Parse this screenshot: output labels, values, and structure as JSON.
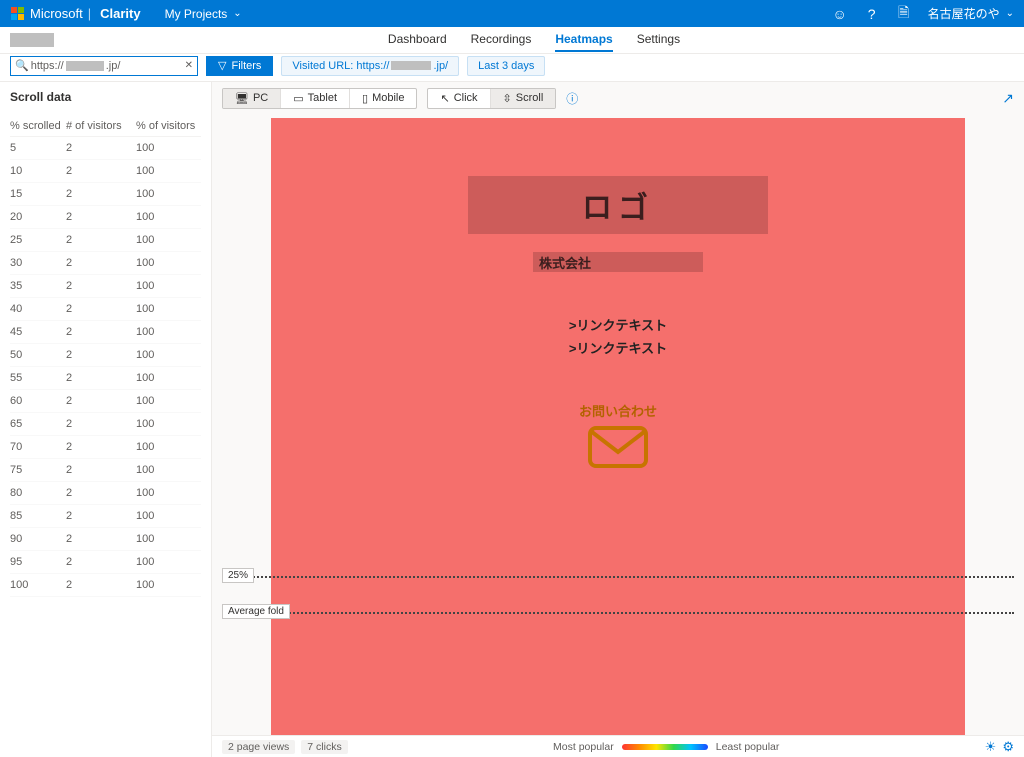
{
  "header": {
    "brand_ms": "Microsoft",
    "brand_app": "Clarity",
    "my_projects": "My Projects",
    "user_name": "名古屋花のや"
  },
  "tabs": {
    "dashboard": "Dashboard",
    "recordings": "Recordings",
    "heatmaps": "Heatmaps",
    "settings": "Settings"
  },
  "filters": {
    "url_prefix": "https://",
    "url_suffix": ".jp/",
    "filters_btn": "Filters",
    "visited_label": "Visited URL: https://",
    "visited_suffix": ".jp/",
    "date_range": "Last 3 days"
  },
  "sidebar": {
    "title": "Scroll data",
    "col1": "% scrolled",
    "col2": "# of visitors",
    "col3": "% of visitors",
    "rows": [
      {
        "s": "5",
        "v": "2",
        "p": "100"
      },
      {
        "s": "10",
        "v": "2",
        "p": "100"
      },
      {
        "s": "15",
        "v": "2",
        "p": "100"
      },
      {
        "s": "20",
        "v": "2",
        "p": "100"
      },
      {
        "s": "25",
        "v": "2",
        "p": "100"
      },
      {
        "s": "30",
        "v": "2",
        "p": "100"
      },
      {
        "s": "35",
        "v": "2",
        "p": "100"
      },
      {
        "s": "40",
        "v": "2",
        "p": "100"
      },
      {
        "s": "45",
        "v": "2",
        "p": "100"
      },
      {
        "s": "50",
        "v": "2",
        "p": "100"
      },
      {
        "s": "55",
        "v": "2",
        "p": "100"
      },
      {
        "s": "60",
        "v": "2",
        "p": "100"
      },
      {
        "s": "65",
        "v": "2",
        "p": "100"
      },
      {
        "s": "70",
        "v": "2",
        "p": "100"
      },
      {
        "s": "75",
        "v": "2",
        "p": "100"
      },
      {
        "s": "80",
        "v": "2",
        "p": "100"
      },
      {
        "s": "85",
        "v": "2",
        "p": "100"
      },
      {
        "s": "90",
        "v": "2",
        "p": "100"
      },
      {
        "s": "95",
        "v": "2",
        "p": "100"
      },
      {
        "s": "100",
        "v": "2",
        "p": "100"
      }
    ]
  },
  "toolbar": {
    "pc": "PC",
    "tablet": "Tablet",
    "mobile": "Mobile",
    "click": "Click",
    "scroll": "Scroll"
  },
  "mock": {
    "logo": "ロゴ",
    "company": "株式会社",
    "link1": ">リンクテキスト",
    "link2": ">リンクテキスト",
    "contact": "お問い合わせ",
    "label_25": "25%",
    "label_fold": "Average fold"
  },
  "footer": {
    "pageviews": "2 page views",
    "clicks": "7 clicks",
    "most": "Most popular",
    "least": "Least popular"
  }
}
